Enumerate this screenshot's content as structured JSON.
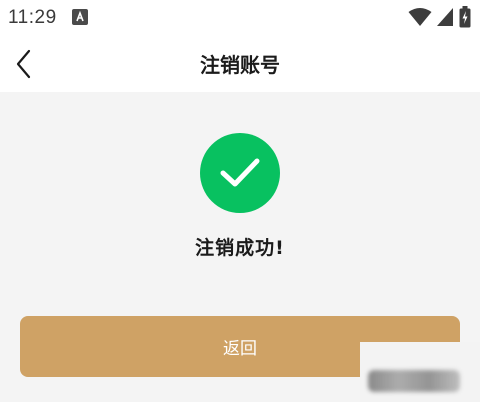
{
  "status_bar": {
    "time": "11:29",
    "icons": [
      "accessibility-a-icon",
      "wifi-icon",
      "cellular-signal-icon",
      "battery-charging-icon"
    ]
  },
  "nav": {
    "title": "注销账号",
    "back_icon": "chevron-left-icon"
  },
  "result": {
    "icon": "check-circle-icon",
    "message": "注销成功!"
  },
  "actions": {
    "return_label": "返回"
  },
  "colors": {
    "success": "#08c160",
    "button": "#cfa265",
    "background": "#f4f4f4",
    "title_text": "#1b1b1b"
  }
}
